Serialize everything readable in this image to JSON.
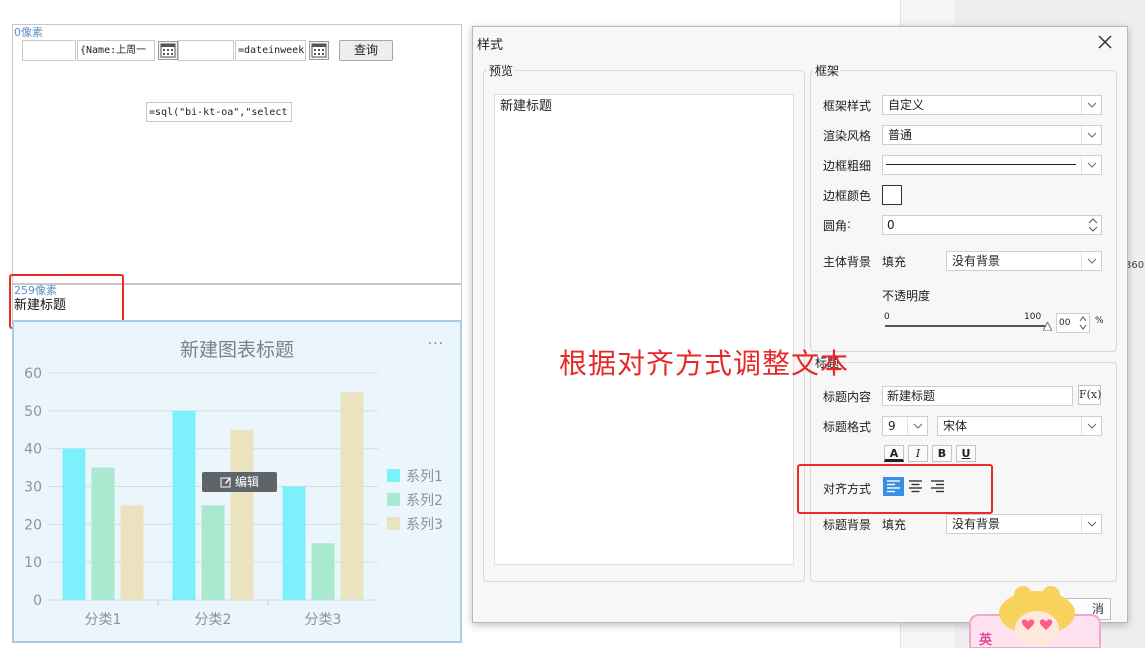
{
  "dialog": {
    "title": "样式",
    "preview": {
      "label": "预览",
      "title_text": "新建标题"
    },
    "frame": {
      "label": "框架",
      "style_label": "框架样式",
      "style_value": "自定义",
      "render_label": "渲染风格",
      "render_value": "普通",
      "border_width_label": "边框粗细",
      "border_color_label": "边框颜色",
      "radius_label": "圆角",
      "radius_value": "0",
      "body_bg_label": "主体背景",
      "body_bg_fill": "填充",
      "body_bg_value": "没有背景",
      "opacity_label": "不透明度",
      "opacity_min": "0",
      "opacity_max": "100",
      "opacity_value": "00",
      "opacity_unit": "%"
    },
    "title_group": {
      "label": "标题",
      "content_label": "标题内容",
      "content_value": "新建标题",
      "fx_label": "F(x)",
      "format_label": "标题格式",
      "font_size": "9",
      "font_name": "宋体",
      "btn_color": "A",
      "btn_italic": "I",
      "btn_bold": "B",
      "btn_underline": "U",
      "align_label": "对齐方式",
      "bg_label": "标题背景",
      "bg_fill": "填充",
      "bg_value": "没有背景"
    },
    "cancel_label": "消"
  },
  "annotation": "根据对齐方式调整文本",
  "canvas": {
    "px_label_top": "0像素",
    "px_label_mid": "259像素",
    "param_name_cell": "{Name:上周一",
    "param_date_cell": "=dateinweek",
    "query_button": "查询",
    "sql_cell_line1": "=sql(\"bi-kt-oa\",\"select",
    "title_text": "新建标题",
    "edit_chip": "编辑",
    "more": "···"
  },
  "right_panel": {
    "clip_text": "360"
  },
  "mascot_text": "英",
  "chart_data": {
    "type": "bar",
    "title": "新建图表标题",
    "categories": [
      "分类1",
      "分类2",
      "分类3"
    ],
    "series": [
      {
        "name": "系列1",
        "values": [
          40,
          50,
          30
        ],
        "color": "#7cf0fb"
      },
      {
        "name": "系列2",
        "values": [
          35,
          25,
          15
        ],
        "color": "#a9e9cf"
      },
      {
        "name": "系列3",
        "values": [
          25,
          45,
          55
        ],
        "color": "#ebe2bf"
      }
    ],
    "ylim": [
      0,
      60
    ],
    "yticks": [
      0,
      10,
      20,
      30,
      40,
      50,
      60
    ],
    "legend": "right",
    "grid": true
  },
  "colors": {
    "accent_blue": "#3a8ee6",
    "annotation_red": "#e62a2a",
    "chart_bg": "#eaf6fb"
  }
}
